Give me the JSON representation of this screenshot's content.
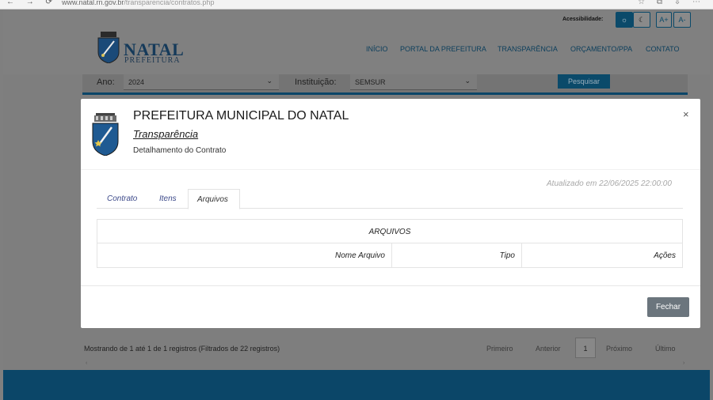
{
  "browser": {
    "nav_icons": "← → ⟳",
    "url_host": "www.natal.rn.gov.br",
    "url_path": "/transparencia/contratos.php",
    "tool_icons": "☆ ⧉ ⇩ ⋯"
  },
  "site": {
    "logo_title": "NATAL",
    "logo_subtitle": "PREFEITURA",
    "accessibility_label": "Acessibilidade:",
    "acc_contrast_icon": "☼",
    "acc_dark_icon": "☾",
    "acc_increase": "A+",
    "acc_decrease": "A-",
    "menu": [
      "INÍCIO",
      "PORTAL DA PREFEITURA",
      "TRANSPARÊNCIA",
      "ORÇAMENTO/PPA",
      "CONTATO"
    ]
  },
  "filters": {
    "ano_label": "Ano:",
    "ano_value": "2024",
    "instituicao_label": "Instituição:",
    "instituicao_value": "SEMSUR",
    "chevron": "⌄",
    "search_button": "Pesquisar"
  },
  "listing": {
    "info": "Mostrando de 1 até 1 de 1 registros (Filtrados de 22 registros)",
    "pagination": {
      "first": "Primeiro",
      "previous": "Anterior",
      "current": "1",
      "next": "Próximo",
      "last": "Último"
    },
    "scroll_left": "‹",
    "scroll_right": "›"
  },
  "modal": {
    "title": "PREFEITURA MUNICIPAL DO NATAL",
    "link": "Transparência",
    "subtitle": "Detalhamento do Contrato",
    "close_icon": "×",
    "updated": "Atualizado em 22/06/2025 22:00:00",
    "tabs": [
      "Contrato",
      "Itens",
      "Arquivos"
    ],
    "active_tab": "Arquivos",
    "table": {
      "caption": "ARQUIVOS",
      "columns": [
        "Nome Arquivo",
        "Tipo",
        "Ações"
      ]
    },
    "close_button": "Fechar"
  },
  "colors": {
    "brand_blue": "#0b4668",
    "tab_link": "#3d4a8a",
    "button_gray": "#6b757d"
  }
}
